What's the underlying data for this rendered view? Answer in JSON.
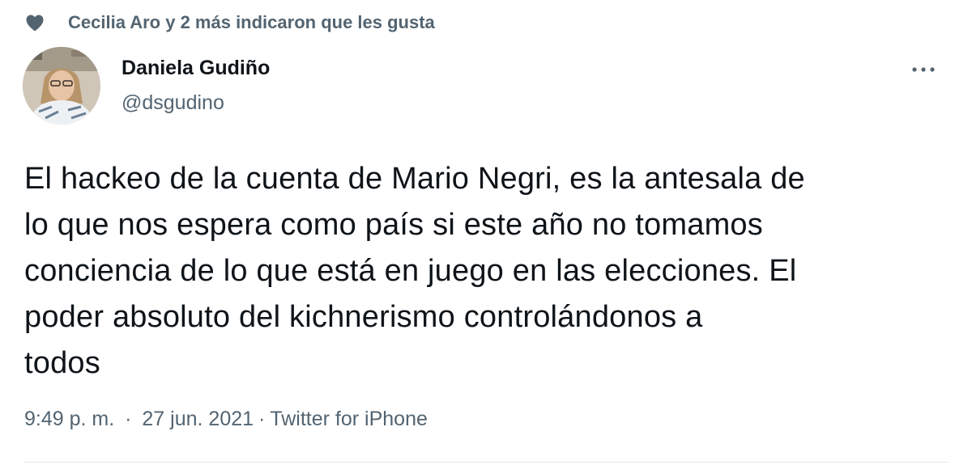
{
  "social_context": {
    "icon": "heart-icon",
    "text": "Cecilia Aro y 2 más indicaron que les gusta",
    "color": "#536471"
  },
  "author": {
    "display_name": "Daniela Gudiño",
    "handle": "@dsgudino",
    "avatar_icon": "avatar-photo"
  },
  "more_menu": {
    "icon": "more-horizontal-icon"
  },
  "tweet": {
    "lines": [
      "El hackeo de la cuenta de Mario Negri, es la antesala de",
      "lo que nos espera como país si este año no tomamos",
      "conciencia de lo que está en juego en las elecciones. El",
      "poder absoluto del kichnerismo controlándonos a",
      "todos"
    ]
  },
  "meta": {
    "time": "9:49 p. m.",
    "separator": "·",
    "date": "27 jun. 2021",
    "source": "Twitter for iPhone"
  },
  "colors": {
    "text_primary": "#0f1419",
    "text_secondary": "#536471",
    "divider": "#e1e8ed"
  }
}
